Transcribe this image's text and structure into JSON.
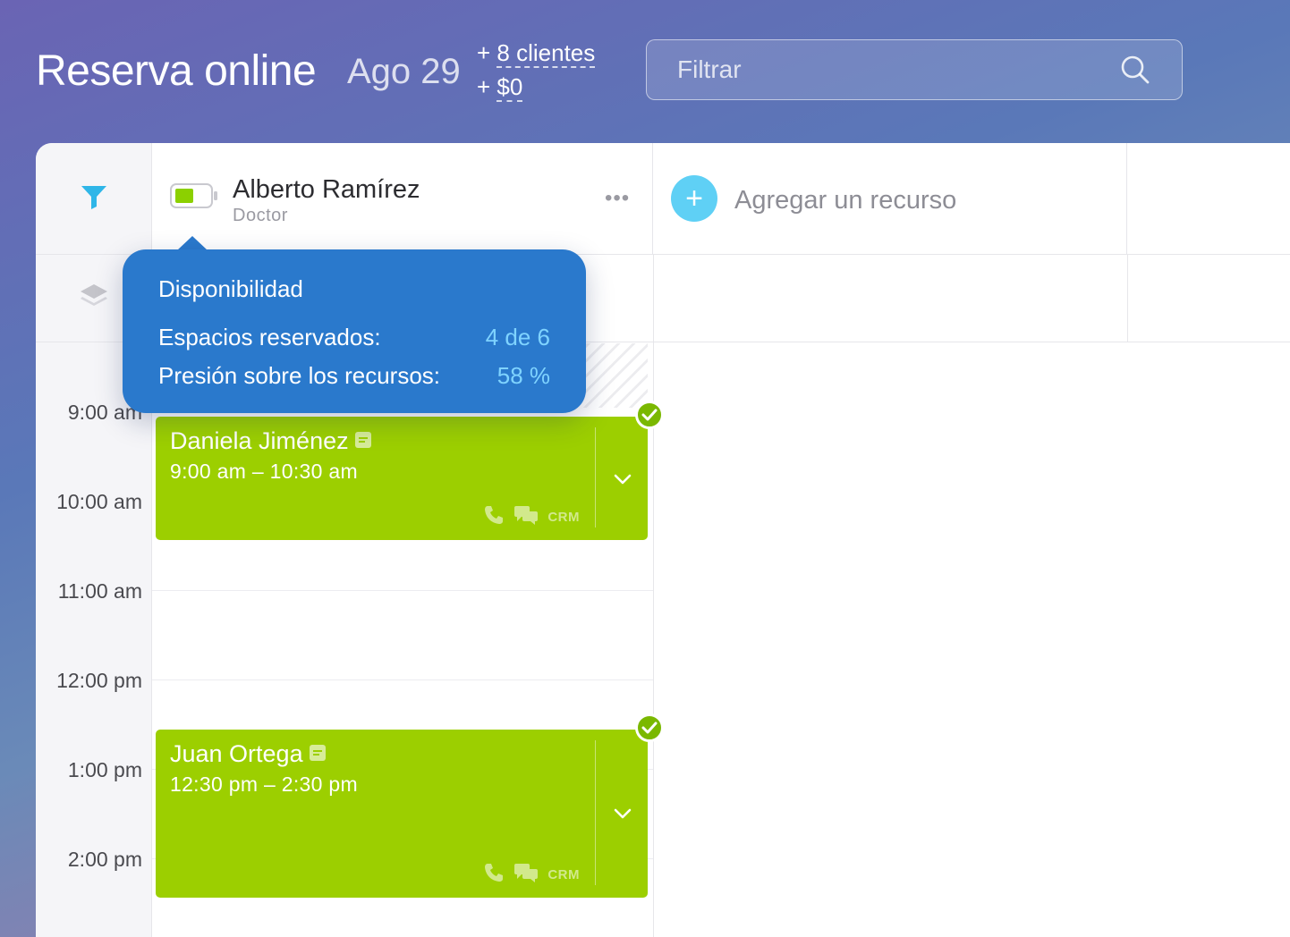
{
  "header": {
    "title": "Reserva online",
    "date": "Ago 29",
    "stats": {
      "clients_prefix": "+ ",
      "clients": "8 clientes",
      "revenue_prefix": "+ ",
      "revenue": "$0"
    },
    "search": {
      "placeholder": "Filtrar",
      "value": ""
    }
  },
  "resource": {
    "name": "Alberto Ramírez",
    "role": "Doctor",
    "more": "•••"
  },
  "add_resource": {
    "icon": "+",
    "label": "Agregar un recurso"
  },
  "time_labels": [
    "9:00 am",
    "10:00 am",
    "11:00 am",
    "12:00 pm",
    "1:00 pm",
    "2:00 pm"
  ],
  "appointments": [
    {
      "name": "Daniela Jiménez",
      "time": "9:00 am – 10:30 am",
      "crm": "CRM"
    },
    {
      "name": "Juan Ortega",
      "time": "12:30 pm – 2:30 pm",
      "crm": "CRM"
    }
  ],
  "tooltip": {
    "title": "Disponibilidad",
    "rows": [
      {
        "label": "Espacios reservados:",
        "value": "4 de 6"
      },
      {
        "label": "Presión sobre los recursos:",
        "value": "58 %"
      }
    ]
  },
  "colors": {
    "accent_blue": "#2a79cc",
    "appointment_green": "#9ccf00",
    "add_button": "#5fd0f5",
    "filter_icon": "#2fb6e8"
  },
  "icons": {
    "filter": "filter-icon",
    "layers": "layers-icon",
    "battery": "battery-icon",
    "search": "search-icon",
    "note": "note-icon",
    "phone": "phone-icon",
    "chat": "chat-icon",
    "chevron": "chevron-down-icon",
    "check": "check-icon"
  }
}
